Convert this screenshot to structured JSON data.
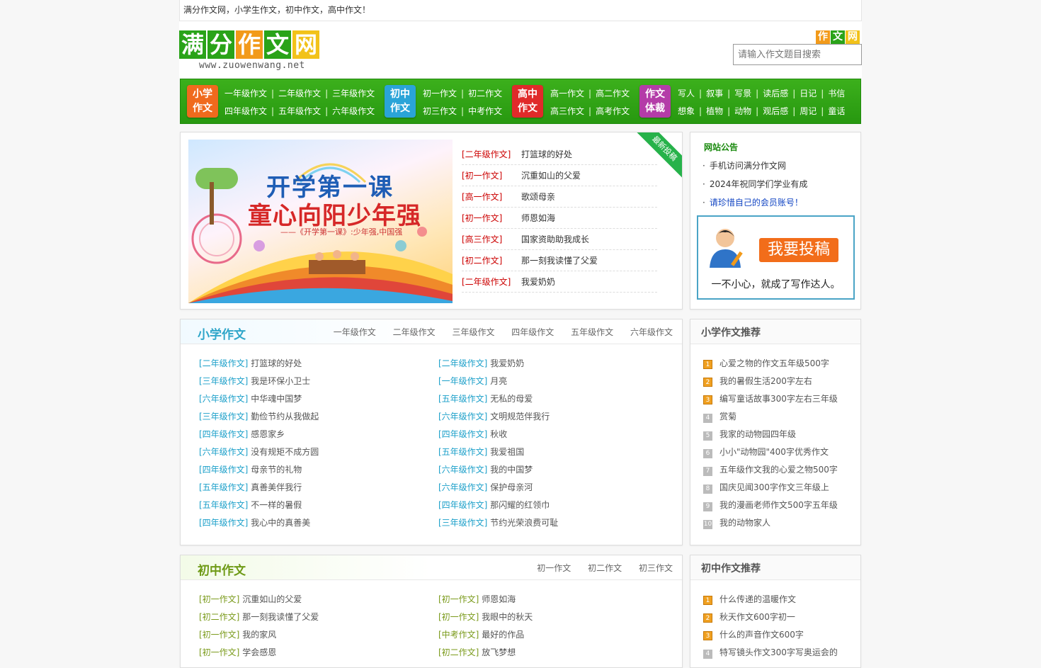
{
  "topbar": {
    "text": "满分作文网，小学生作文，初中作文，高中作文！"
  },
  "logo": {
    "chars": [
      "满",
      "分",
      "作",
      "文",
      "网"
    ],
    "url": "www.zuowenwang.net",
    "mini": [
      "作",
      "文",
      "网"
    ]
  },
  "search": {
    "placeholder": "请输入作文题目搜索"
  },
  "nav": [
    {
      "badge": [
        "小学",
        "作文"
      ],
      "color": "#f06a1d",
      "rows": [
        [
          "一年级作文",
          "二年级作文",
          "三年级作文"
        ],
        [
          "四年级作文",
          "五年级作文",
          "六年级作文"
        ]
      ]
    },
    {
      "badge": [
        "初中",
        "作文"
      ],
      "color": "#2aa4d8",
      "rows": [
        [
          "初一作文",
          "初二作文"
        ],
        [
          "初三作文",
          "中考作文"
        ]
      ]
    },
    {
      "badge": [
        "高中",
        "作文"
      ],
      "color": "#e02a2a",
      "rows": [
        [
          "高一作文",
          "高二作文"
        ],
        [
          "高三作文",
          "高考作文"
        ]
      ]
    },
    {
      "badge": [
        "作文",
        "体裁"
      ],
      "color": "#b43ca8",
      "rows": [
        [
          "写人",
          "叙事",
          "写景",
          "读后感",
          "日记",
          "书信"
        ],
        [
          "想象",
          "植物",
          "动物",
          "观后感",
          "周记",
          "童话"
        ]
      ]
    }
  ],
  "banner": {
    "line1": "开学第一课",
    "line2": "童心向阳少年强",
    "line3": "——《开学第一课》:少年强,中国强"
  },
  "corner": "最新投稿",
  "latest": [
    {
      "cat": "[二年级作文]",
      "title": "打篮球的好处"
    },
    {
      "cat": "[初一作文]",
      "title": "沉重如山的父爱"
    },
    {
      "cat": "[高一作文]",
      "title": "歌颂母亲"
    },
    {
      "cat": "[初一作文]",
      "title": "师恩如海"
    },
    {
      "cat": "[高三作文]",
      "title": "国家资助助我成长"
    },
    {
      "cat": "[初二作文]",
      "title": "那一刻我读懂了父爱"
    },
    {
      "cat": "[二年级作文]",
      "title": "我爱奶奶"
    }
  ],
  "notice": {
    "title": "网站公告",
    "items": [
      "手机访问满分作文网",
      "2024年祝同学们学业有成",
      "请珍惜自己的会员账号！"
    ],
    "tougao_btn": "我要投稿",
    "tougao_slogan": "一不小心，就成了写作达人。"
  },
  "primary": {
    "title": "小学作文",
    "tabs": [
      "一年级作文",
      "二年级作文",
      "三年级作文",
      "四年级作文",
      "五年级作文",
      "六年级作文"
    ],
    "left": [
      {
        "cat": "[二年级作文]",
        "title": "打篮球的好处"
      },
      {
        "cat": "[三年级作文]",
        "title": "我是环保小卫士"
      },
      {
        "cat": "[六年级作文]",
        "title": "中华魂中国梦"
      },
      {
        "cat": "[三年级作文]",
        "title": "勤俭节约从我做起"
      },
      {
        "cat": "[四年级作文]",
        "title": "感恩家乡"
      },
      {
        "cat": "[六年级作文]",
        "title": "没有规矩不成方圆"
      },
      {
        "cat": "[四年级作文]",
        "title": "母亲节的礼物"
      },
      {
        "cat": "[五年级作文]",
        "title": "真善美伴我行"
      },
      {
        "cat": "[五年级作文]",
        "title": "不一样的暑假"
      },
      {
        "cat": "[四年级作文]",
        "title": "我心中的真善美"
      }
    ],
    "right": [
      {
        "cat": "[二年级作文]",
        "title": "我爱奶奶"
      },
      {
        "cat": "[一年级作文]",
        "title": "月亮"
      },
      {
        "cat": "[五年级作文]",
        "title": "无私的母爱"
      },
      {
        "cat": "[六年级作文]",
        "title": "文明规范伴我行"
      },
      {
        "cat": "[四年级作文]",
        "title": "秋收"
      },
      {
        "cat": "[五年级作文]",
        "title": "我爱祖国"
      },
      {
        "cat": "[六年级作文]",
        "title": "我的中国梦"
      },
      {
        "cat": "[六年级作文]",
        "title": "保护母亲河"
      },
      {
        "cat": "[四年级作文]",
        "title": "那闪耀的红领巾"
      },
      {
        "cat": "[三年级作文]",
        "title": "节约光荣浪费可耻"
      }
    ]
  },
  "primary_rank": {
    "title": "小学作文推荐",
    "items": [
      "心爱之物的作文五年级500字",
      "我的暑假生活200字左右",
      "编写童话故事300字左右三年级",
      "赏菊",
      "我家的动物园四年级",
      "小小\"动物园\"400字优秀作文",
      "五年级作文我的心爱之物500字",
      "国庆见闻300字作文三年级上",
      "我的漫画老师作文500字五年级",
      "我的动物家人"
    ]
  },
  "junior": {
    "title": "初中作文",
    "tabs": [
      "初一作文",
      "初二作文",
      "初三作文"
    ],
    "left": [
      {
        "cat": "[初一作文]",
        "title": "沉重如山的父爱"
      },
      {
        "cat": "[初二作文]",
        "title": "那一刻我读懂了父爱"
      },
      {
        "cat": "[初一作文]",
        "title": "我的家风"
      },
      {
        "cat": "[初一作文]",
        "title": "学会感恩"
      }
    ],
    "right": [
      {
        "cat": "[初一作文]",
        "title": "师恩如海"
      },
      {
        "cat": "[初一作文]",
        "title": "我眼中的秋天"
      },
      {
        "cat": "[中考作文]",
        "title": "最好的作品"
      },
      {
        "cat": "[初二作文]",
        "title": "放飞梦想"
      }
    ]
  },
  "junior_rank": {
    "title": "初中作文推荐",
    "items": [
      "什么传递的温暖作文",
      "秋天作文600字初一",
      "什么的声音作文600字",
      "特写镜头作文300字写奥运会的"
    ]
  },
  "colors": {
    "green": "#2c9f15",
    "primary_cat": "#1a9fc9",
    "junior_cat": "#7a9a1a",
    "primary_title": "#2fa6c9",
    "junior_title": "#6e9a16"
  }
}
